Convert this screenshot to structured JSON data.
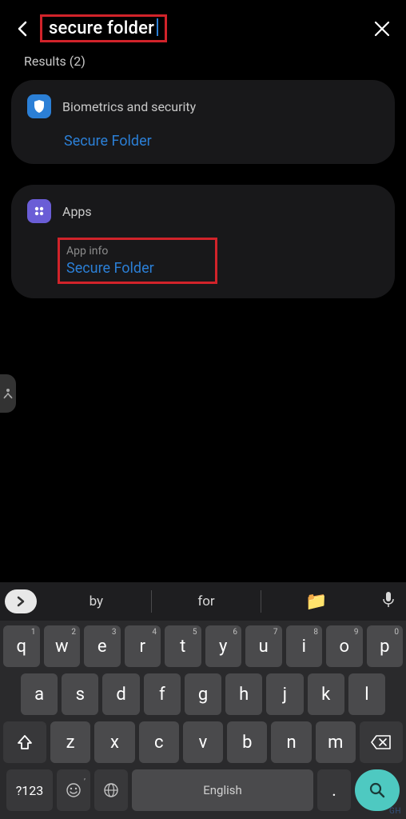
{
  "search": {
    "query": "secure folder",
    "results_label": "Results (2)"
  },
  "results": [
    {
      "icon": "shield",
      "category": "Biometrics and security",
      "sublabel": null,
      "item": "Secure Folder"
    },
    {
      "icon": "apps",
      "category": "Apps",
      "sublabel": "App info",
      "item": "Secure Folder"
    }
  ],
  "keyboard": {
    "suggestions": [
      "by",
      "for"
    ],
    "space_label": "English",
    "symkey": "?123",
    "row1": [
      {
        "k": "q",
        "d": "1"
      },
      {
        "k": "w",
        "d": "2"
      },
      {
        "k": "e",
        "d": "3"
      },
      {
        "k": "r",
        "d": "4"
      },
      {
        "k": "t",
        "d": "5"
      },
      {
        "k": "y",
        "d": "6"
      },
      {
        "k": "u",
        "d": "7"
      },
      {
        "k": "i",
        "d": "8"
      },
      {
        "k": "o",
        "d": "9"
      },
      {
        "k": "p",
        "d": "0"
      }
    ],
    "row2": [
      "a",
      "s",
      "d",
      "f",
      "g",
      "h",
      "j",
      "k",
      "l"
    ],
    "row3": [
      "z",
      "x",
      "c",
      "v",
      "b",
      "n",
      "m"
    ]
  }
}
